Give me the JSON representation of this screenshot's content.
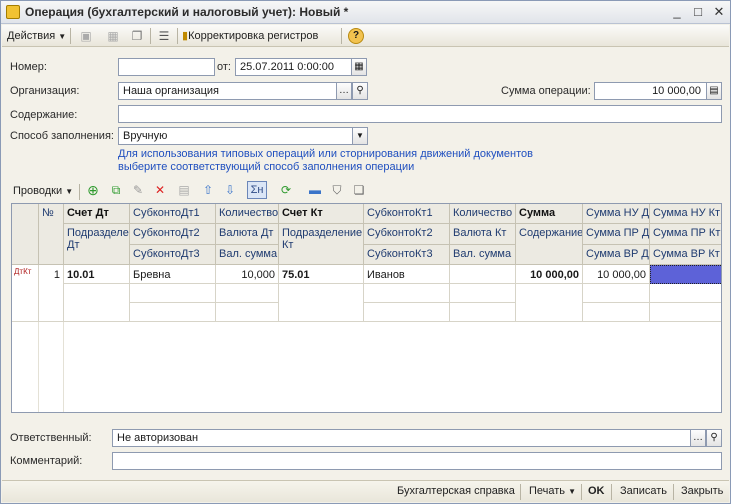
{
  "window": {
    "title": "Операция (бухгалтерский и налоговый учет): Новый *",
    "min_glyph": "_",
    "max_glyph": "□",
    "close_glyph": "✕"
  },
  "toolbar": {
    "actions_label": "Действия",
    "register_adjust_label": "Корректировка регистров",
    "help_glyph": "?"
  },
  "form": {
    "number_label": "Номер:",
    "number_value": "",
    "date_label": "от:",
    "date_value": "25.07.2011  0:00:00",
    "org_label": "Организация:",
    "org_value": "Наша организация",
    "sum_label": "Сумма операции:",
    "sum_value": "10 000,00",
    "content_label": "Содержание:",
    "content_value": "",
    "fill_label": "Способ заполнения:",
    "fill_value": "Вручную",
    "hint_line1": "Для использования типовых операций или сторнирования движений документов",
    "hint_line2": "выберите соответствующий способ заполнения операции"
  },
  "postings": {
    "label": "Проводки",
    "headers": {
      "num": "№",
      "debit_account": "Счет Дт",
      "debit_subdivision": "Подразделение Дт",
      "subkonto_dt1": "СубконтоДт1",
      "subkonto_dt2": "СубконтоДт2",
      "subkonto_dt3": "СубконтоДт3",
      "qty_dt": "Количество Дт",
      "currency_dt": "Валюта Дт",
      "cur_sum_dt": "Вал. сумма Дт",
      "credit_account": "Счет Кт",
      "credit_subdivision": "Подразделение Кт",
      "subkonto_kt1": "СубконтоКт1",
      "subkonto_kt2": "СубконтоКт2",
      "subkonto_kt3": "СубконтоКт3",
      "qty_kt": "Количество Кт",
      "currency_kt": "Валюта Кт",
      "cur_sum_kt": "Вал. сумма Кт",
      "sum": "Сумма",
      "content": "Содержание",
      "sum_nu_dt": "Сумма НУ Дт",
      "sum_pr_dt": "Сумма ПР Дт",
      "sum_vr_dt": "Сумма ВР Дт",
      "sum_nu_kt": "Сумма НУ Кт",
      "sum_pr_kt": "Сумма ПР Кт",
      "sum_vr_kt": "Сумма ВР Кт"
    },
    "rows": [
      {
        "icon": "ДтКт",
        "num": "1",
        "debit_account": "10.01",
        "subkonto_dt1": "Бревна",
        "qty_dt": "10,000",
        "credit_account": "75.01",
        "subkonto_kt1": "Иванов",
        "sum": "10 000,00",
        "sum_nu_dt": "10 000,00"
      }
    ]
  },
  "bottom": {
    "responsible_label": "Ответственный:",
    "responsible_value": "Не авторизован",
    "comment_label": "Комментарий:",
    "comment_value": ""
  },
  "footer": {
    "accounting_note": "Бухгалтерская справка",
    "print_label": "Печать",
    "ok_label": "OK",
    "write_label": "Записать",
    "close_label": "Закрыть"
  },
  "colors": {
    "accent_selection": "#5d62d8",
    "hint_text": "#1f4fbf"
  }
}
